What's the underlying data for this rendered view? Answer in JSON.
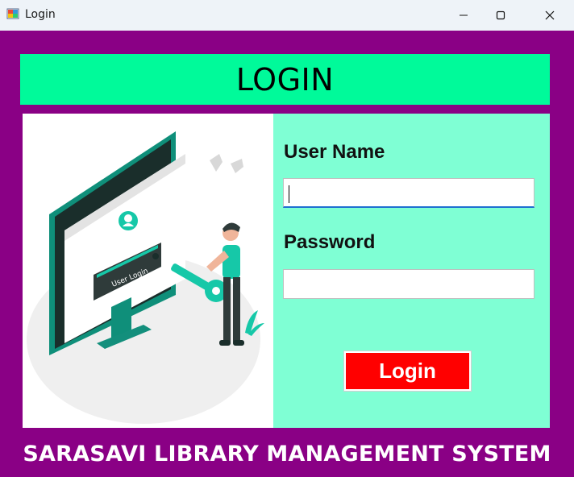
{
  "window": {
    "title": "Login",
    "icons": {
      "app": "app-icon",
      "minimize": "minimize-icon",
      "maximize": "maximize-icon",
      "close": "close-icon"
    }
  },
  "header": {
    "title": "LOGIN"
  },
  "illustration": {
    "card_text": "User Login",
    "icon": "user-login-illustration"
  },
  "form": {
    "username_label": "User Name",
    "username_value": "",
    "password_label": "Password",
    "password_value": "",
    "login_button": "Login"
  },
  "footer": {
    "text": "SARASAVI LIBRARY MANAGEMENT SYSTEM"
  },
  "colors": {
    "background": "#8a0085",
    "header_band": "#00fa9a",
    "form_panel": "#7fffd4",
    "login_button": "#ff0000",
    "illustration_accent": "#16c8a8"
  }
}
